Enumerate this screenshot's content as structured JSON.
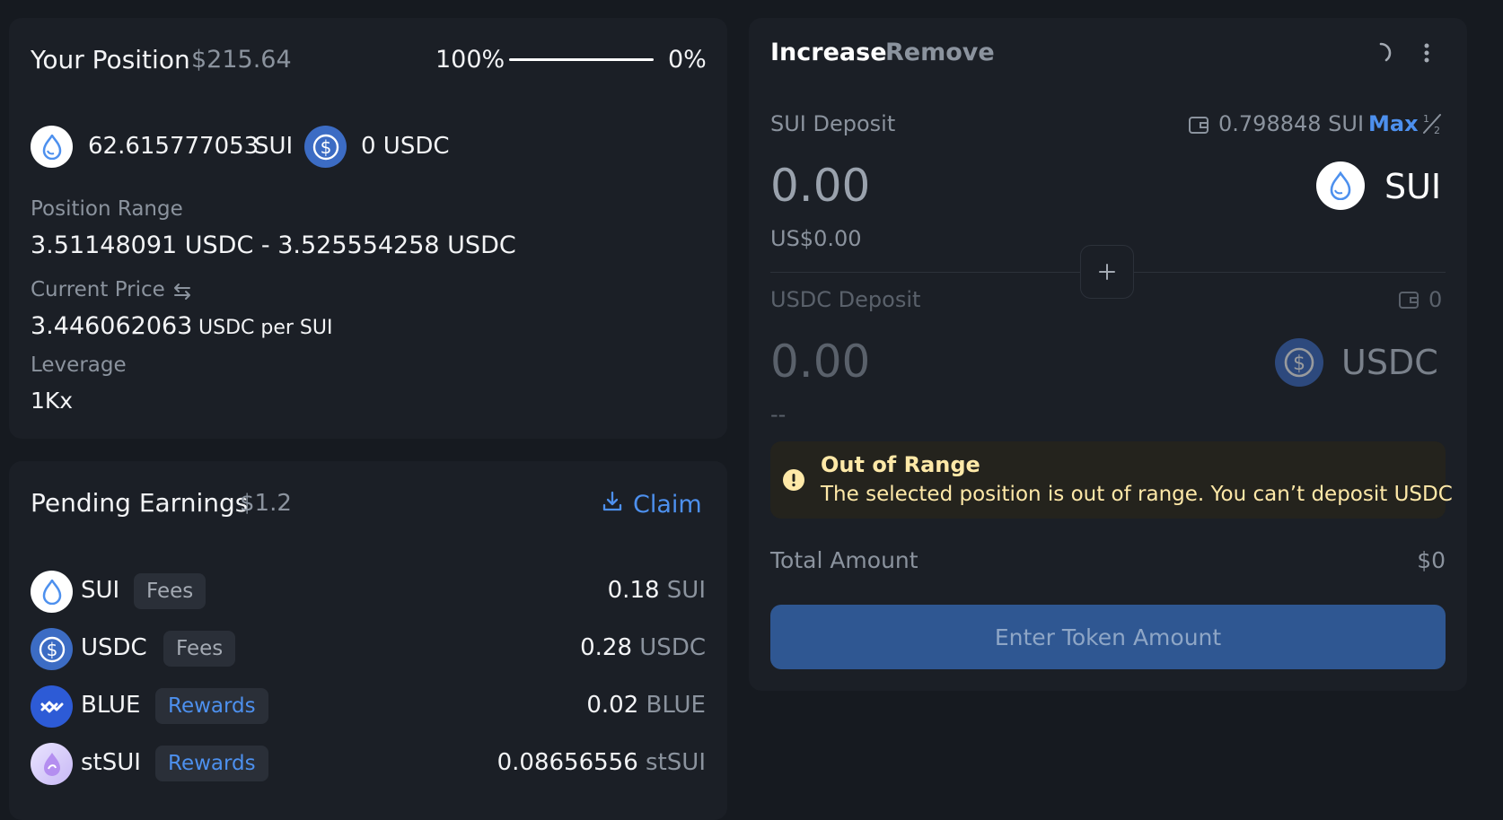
{
  "position": {
    "title": "Your Position",
    "value": "$215.64",
    "ratio_left": "100%",
    "ratio_right": "0%",
    "ratio_fill": 1.0,
    "token_a_amount": "62.615777053",
    "token_a_symbol": "SUI",
    "token_b_amount": "0 USDC",
    "range_label": "Position Range",
    "range_value": "3.51148091 USDC - 3.525554258 USDC",
    "price_label": "Current Price",
    "price_value": "3.446062063",
    "price_unit": "USDC per SUI",
    "leverage_label": "Leverage",
    "leverage_value": "1Kx"
  },
  "earnings": {
    "title": "Pending Earnings",
    "value": "$1.2",
    "claim_label": "Claim",
    "items": [
      {
        "symbol": "SUI",
        "badge": "Fees",
        "amount": "0.18",
        "unit": "SUI",
        "icon": "sui-icon"
      },
      {
        "symbol": "USDC",
        "badge": "Fees",
        "amount": "0.28",
        "unit": "USDC",
        "icon": "usdc-icon"
      },
      {
        "symbol": "BLUE",
        "badge": "Rewards",
        "amount": "0.02",
        "unit": "BLUE",
        "icon": "blue-icon"
      },
      {
        "symbol": "stSUI",
        "badge": "Rewards",
        "amount": "0.08656556",
        "unit": "stSUI",
        "icon": "stsui-icon"
      }
    ]
  },
  "manage": {
    "tab_increase": "Increase",
    "tab_remove": "Remove",
    "sui_deposit_label": "SUI Deposit",
    "sui_balance": "0.798848 SUI",
    "max_label": "Max",
    "sui_amount": "0.00",
    "sui_symbol": "SUI",
    "sui_usd": "US$0.00",
    "usdc_deposit_label": "USDC Deposit",
    "usdc_balance": "0",
    "usdc_amount": "0.00",
    "usdc_symbol": "USDC",
    "usdc_usd": "--",
    "warning_title": "Out of Range",
    "warning_text": "The selected position is out of range. You can’t deposit USDC",
    "total_label": "Total Amount",
    "total_value": "$0",
    "enter_button": "Enter Token Amount"
  },
  "colors": {
    "background": "#161a20",
    "card": "#1b1f26",
    "accent": "#4d90ee",
    "warning": "#ffe9a8"
  }
}
